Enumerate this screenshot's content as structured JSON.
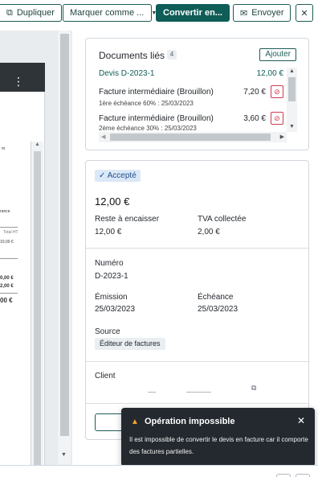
{
  "toolbar": {
    "duplicate": "Dupliquer",
    "mark_as": "Marquer comme ...",
    "convert": "Convertir en...",
    "send": "Envoyer",
    "close": "✕"
  },
  "preview": {
    "frag_m": "m",
    "frag_rance": "rance",
    "frag_totalht": "Total HT",
    "frag_v1": "10,00 €",
    "frag_v2": "0,00 €",
    "frag_v3": "2,00 €",
    "frag_total": "00 €"
  },
  "linked_docs": {
    "title": "Documents liés",
    "count": "4",
    "add": "Ajouter",
    "main": {
      "name": "Devis D-2023-1",
      "amount": "12,00 €"
    },
    "items": [
      {
        "name": "Facture intermédiaire (Brouillon)",
        "amount": "7,20 €",
        "sub": "1ère échéance 60% : 25/03/2023"
      },
      {
        "name": "Facture intermédiaire (Brouillon)",
        "amount": "3,60 €",
        "sub": "2ème échéance 30% : 25/03/2023"
      }
    ]
  },
  "info": {
    "status": "Accepté",
    "total": "12,00 €",
    "remaining_label": "Reste à encaisser",
    "remaining_value": "12,00 €",
    "vat_label": "TVA collectée",
    "vat_value": "2,00 €",
    "number_label": "Numéro",
    "number_value": "D-2023-1",
    "issue_label": "Émission",
    "issue_value": "25/03/2023",
    "due_label": "Échéance",
    "due_value": "25/03/2023",
    "source_label": "Source",
    "source_value": "Éditeur de factures",
    "client_label": "Client"
  },
  "toast": {
    "title": "Opération impossible",
    "message": "Il est impossible de convertir le devis en facture car il comporte des factures partielles."
  }
}
